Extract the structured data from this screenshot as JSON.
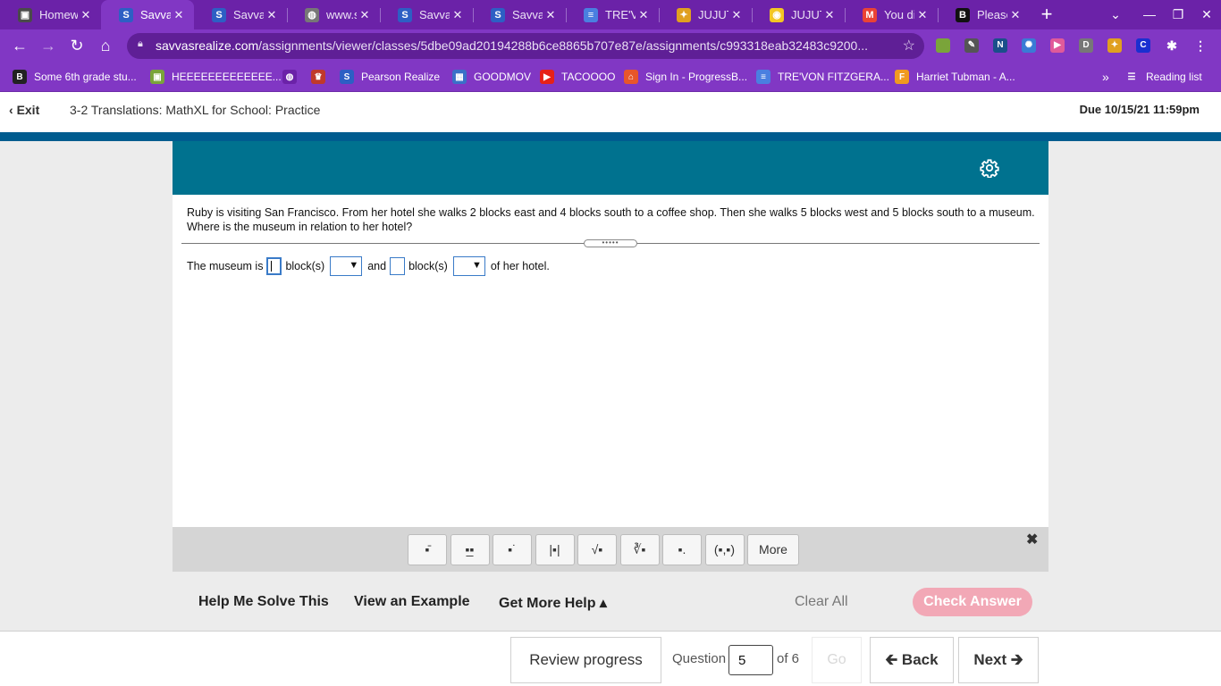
{
  "browser": {
    "tabs": [
      {
        "title": "Homew",
        "fav_color": "#4a4a4a",
        "fav_glyph": "▣",
        "active": false
      },
      {
        "title": "Savvas",
        "fav_color": "#2d5fc4",
        "fav_glyph": "S",
        "active": true
      },
      {
        "title": "Savvas",
        "fav_color": "#2d5fc4",
        "fav_glyph": "S",
        "active": false
      },
      {
        "title": "www.sa",
        "fav_color": "#777777",
        "fav_glyph": "◍",
        "active": false
      },
      {
        "title": "Savvas",
        "fav_color": "#2d5fc4",
        "fav_glyph": "S",
        "active": false
      },
      {
        "title": "Savvas",
        "fav_color": "#2d5fc4",
        "fav_glyph": "S",
        "active": false
      },
      {
        "title": "TRE'VO",
        "fav_color": "#4a7fe0",
        "fav_glyph": "≡",
        "active": false
      },
      {
        "title": "JUJUT",
        "fav_color": "#e0a020",
        "fav_glyph": "✦",
        "active": false
      },
      {
        "title": "JUJUT",
        "fav_color": "#f3c623",
        "fav_glyph": "◉",
        "active": false
      },
      {
        "title": "You dic",
        "fav_color": "#ea4335",
        "fav_glyph": "M",
        "active": false
      },
      {
        "title": "Please",
        "fav_color": "#111111",
        "fav_glyph": "B",
        "active": false
      }
    ],
    "new_tab_glyph": "+",
    "url_host": "savvasrealize.com",
    "url_path": "/assignments/viewer/classes/5dbe09ad20194288b6ce8865b707e87e/assignments/c993318eab32483c9200...",
    "bookmarks": [
      {
        "label": "Some 6th grade stu...",
        "fav_color": "#222222",
        "fav_glyph": "B"
      },
      {
        "label": "HEEEEEEEEEEEEE...",
        "fav_color": "#7aa43a",
        "fav_glyph": "▣"
      },
      {
        "label": "",
        "fav_color": "#6b22a8",
        "fav_glyph": "◍"
      },
      {
        "label": "",
        "fav_color": "#c0392b",
        "fav_glyph": "♛"
      },
      {
        "label": "Pearson Realize",
        "fav_color": "#2d5fc4",
        "fav_glyph": "S"
      },
      {
        "label": "GOODMOV",
        "fav_color": "#3a70c8",
        "fav_glyph": "▦"
      },
      {
        "label": "TACOOOO",
        "fav_color": "#e62117",
        "fav_glyph": "▶"
      },
      {
        "label": "Sign In - ProgressB...",
        "fav_color": "#e8562a",
        "fav_glyph": "⌂"
      },
      {
        "label": "TRE'VON FITZGERA...",
        "fav_color": "#4a7fe0",
        "fav_glyph": "≡"
      },
      {
        "label": "Harriet Tubman - A...",
        "fav_color": "#f09a20",
        "fav_glyph": "F"
      }
    ],
    "more_bookmarks_glyph": "»",
    "reading_list": "Reading list"
  },
  "page": {
    "exit_label": "Exit",
    "title": "3-2 Translations: MathXL for School: Practice",
    "due": "Due 10/15/21 11:59pm"
  },
  "question": {
    "text": "Ruby is visiting San Francisco. From her hotel she walks 2 blocks east and 4 blocks south to a coffee shop. Then she walks 5 blocks west and 5 blocks south to a museum. Where is the museum in relation to her hotel?",
    "answer_prefix": "The museum is",
    "unit1": "block(s)",
    "connector": "and",
    "unit2": "block(s)",
    "answer_suffix": "of her hotel.",
    "handle_glyph": "•••••"
  },
  "palette": {
    "buttons": [
      "▪̄",
      "▪̲▪",
      "▪˙",
      "|▪|",
      "√▪",
      "∛▪",
      "▪.",
      "(▪,▪)"
    ],
    "more_label": "More",
    "close_glyph": "✖"
  },
  "help": {
    "help_me_solve": "Help Me Solve This",
    "view_example": "View an Example",
    "get_more_help": "Get More Help ▴",
    "clear_all": "Clear All",
    "check_answer": "Check Answer"
  },
  "footer": {
    "review_progress": "Review progress",
    "question_label": "Question",
    "question_number": "5",
    "of_total": "of 6",
    "go_label": "Go",
    "back_label": "🡰 Back",
    "next_label": "Next 🡲"
  }
}
